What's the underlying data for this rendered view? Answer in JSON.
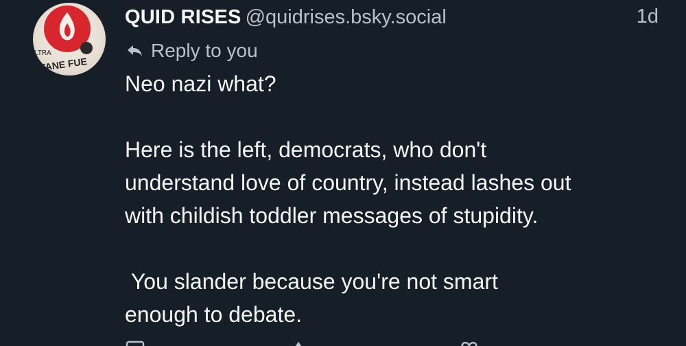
{
  "post": {
    "author": {
      "display_name": "QUID RISES",
      "handle": "@quidrises.bsky.social",
      "avatar_text": [
        "LTRA",
        "UTANE FUE"
      ]
    },
    "timestamp": "1d",
    "reply_label": "Reply to you",
    "paragraphs": [
      "Neo nazi what?",
      "Here is the left, democrats, who don't\nunderstand love of country, instead lashes out\nwith childish toddler messages of stupidity.",
      " You slander because you're not smart\nenough to debate."
    ]
  },
  "colors": {
    "background": "#161e27",
    "primary_text": "#f4f6f8",
    "secondary_text": "#b9c2cc",
    "avatar_red": "#d8262f"
  },
  "icons": [
    "reply-arrow-icon",
    "comment-icon",
    "repost-icon",
    "like-icon",
    "more-icon"
  ]
}
